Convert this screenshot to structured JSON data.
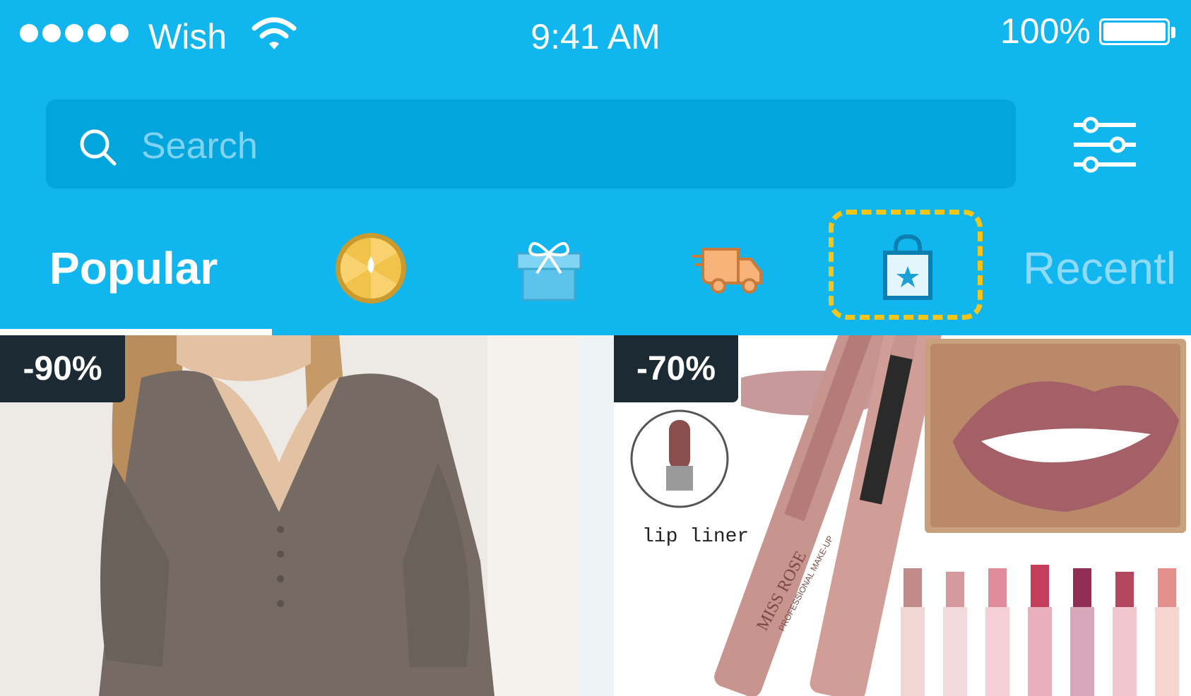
{
  "status_bar": {
    "carrier": "Wish",
    "time": "9:41 AM",
    "battery": "100%"
  },
  "search": {
    "placeholder": "Search"
  },
  "tabs": {
    "popular": "Popular",
    "recent": "Recentl",
    "icons": [
      "spin-wheel-icon",
      "gift-box-icon",
      "fast-delivery-truck-icon",
      "shopping-bag-star-icon"
    ]
  },
  "products": [
    {
      "discount": "-90%",
      "image": "grey-blouse-photo"
    },
    {
      "discount": "-70%",
      "image": "lipstick-set-photo",
      "captions": {
        "lip_liner": "lip liner",
        "brand": "MISS ROSE",
        "tagline": "PROFESSIONAL MAKE-UP"
      }
    }
  ],
  "colors": {
    "header": "#12b6ee",
    "search_bg": "#03a6dc",
    "highlight": "#f5c518",
    "badge": "#1c2a33"
  }
}
